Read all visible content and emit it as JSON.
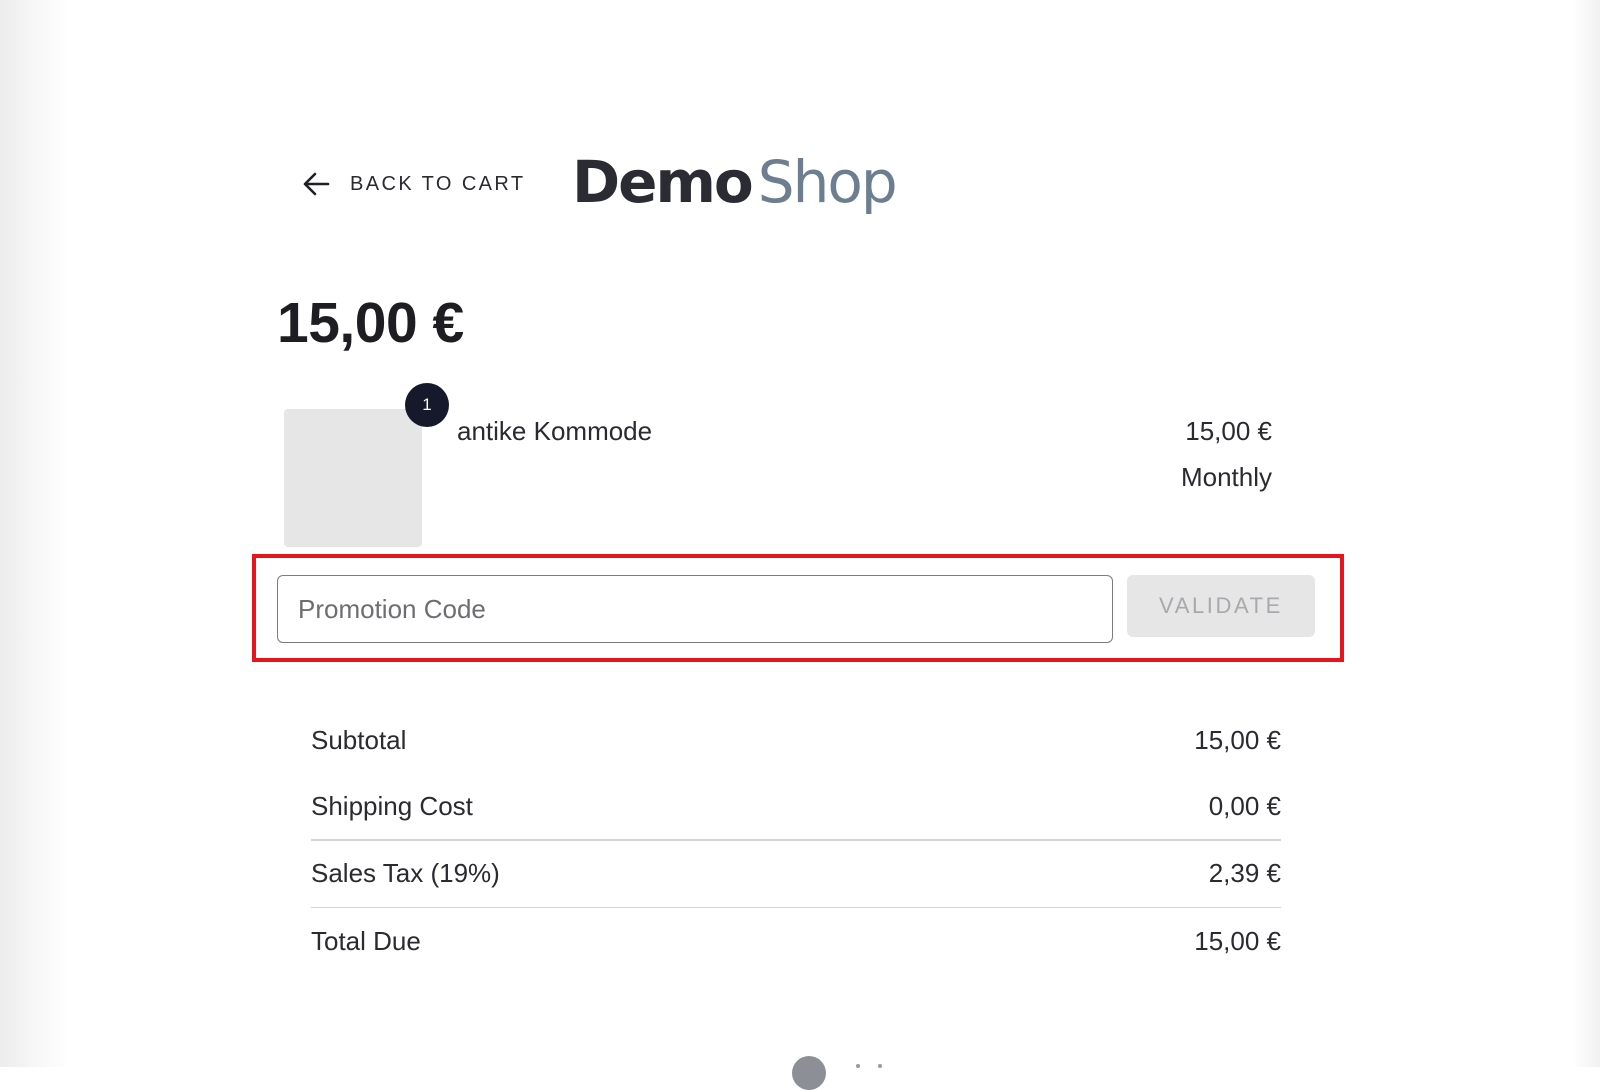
{
  "header": {
    "back_label": "BACK TO CART",
    "logo_part1": "Demo",
    "logo_part2": "Shop"
  },
  "order": {
    "total_amount": "15,00 €"
  },
  "product": {
    "quantity": "1",
    "name": "antike Kommode",
    "price": "15,00 €",
    "period": "Monthly"
  },
  "promotion": {
    "placeholder": "Promotion Code",
    "value": "",
    "button_label": "VALIDATE"
  },
  "summary": {
    "rows": [
      {
        "label": "Subtotal",
        "value": "15,00 €"
      },
      {
        "label": "Shipping Cost",
        "value": "0,00 €"
      },
      {
        "label": "Sales Tax (19%)",
        "value": "2,39 €"
      },
      {
        "label": "Total Due",
        "value": "15,00 €"
      }
    ]
  },
  "colors": {
    "highlight": "#e8141b",
    "badge": "#16182b",
    "logo_dark": "#2b2c33",
    "logo_light": "#6d7e90"
  },
  "icons": {
    "back": "arrow-left-icon"
  }
}
